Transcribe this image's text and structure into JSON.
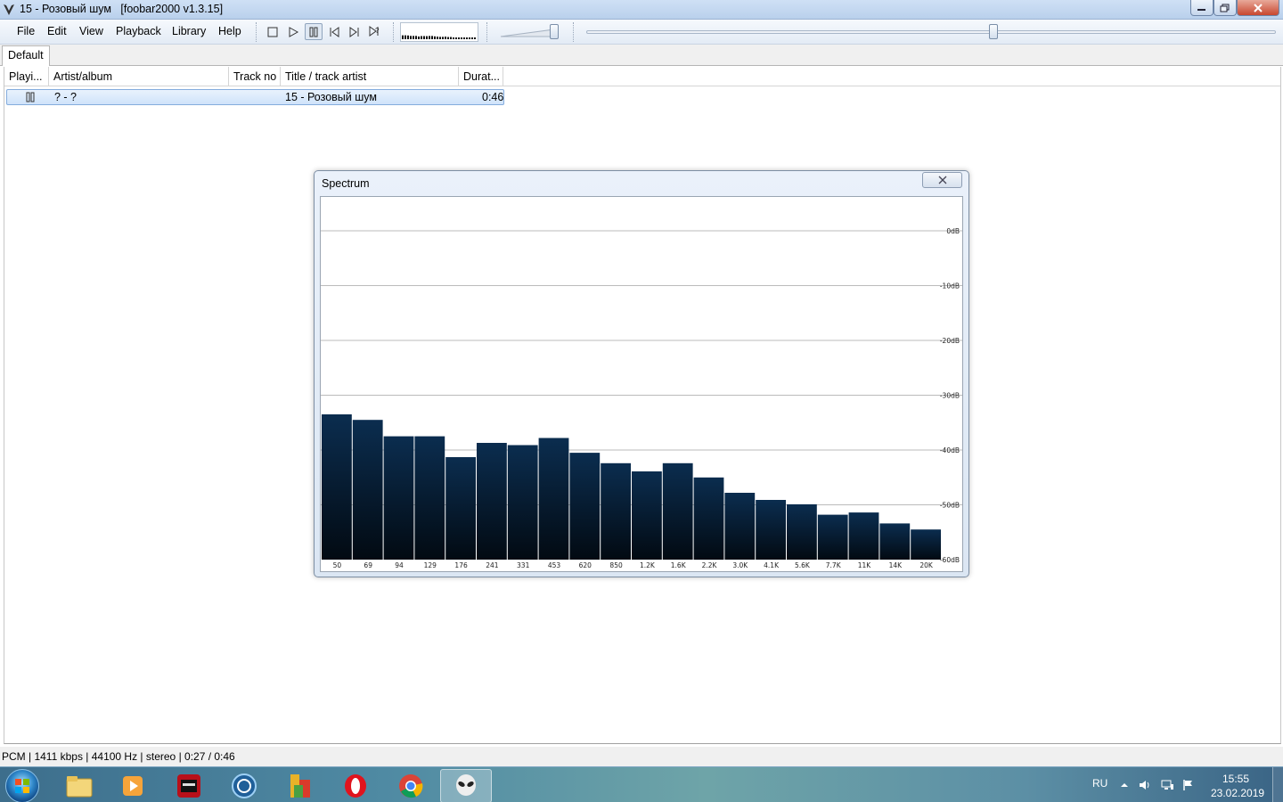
{
  "window": {
    "title": "15 - Розовый шум   [foobar2000 v1.3.15]"
  },
  "menu": [
    "File",
    "Edit",
    "View",
    "Playback",
    "Library",
    "Help"
  ],
  "tabs": [
    "Default"
  ],
  "playlist": {
    "columns": [
      "Playi...",
      "Artist/album",
      "Track no",
      "Title / track artist",
      "Durat..."
    ],
    "rows": [
      {
        "artist_album": "? - ?",
        "track_no": "",
        "title": "15 - Розовый шум",
        "duration": "0:46",
        "state": "paused"
      }
    ]
  },
  "seek": {
    "position_fraction": 0.59
  },
  "volume": {
    "level_fraction": 1.0
  },
  "spectrum": {
    "title": "Spectrum",
    "db_labels": [
      "0dB",
      "-10dB",
      "-20dB",
      "-30dB",
      "-40dB",
      "-50dB",
      "-60dB"
    ],
    "bands": [
      "50",
      "69",
      "94",
      "129",
      "176",
      "241",
      "331",
      "453",
      "620",
      "850",
      "1.2K",
      "1.6K",
      "2.2K",
      "3.0K",
      "4.1K",
      "5.6K",
      "7.7K",
      "11K",
      "14K",
      "20K"
    ],
    "levels_db": [
      -33.5,
      -34.5,
      -37.5,
      -37.5,
      -41.3,
      -38.7,
      -39.1,
      -37.8,
      -40.5,
      -42.4,
      -43.9,
      -42.4,
      -45.0,
      -47.8,
      -49.1,
      -49.9,
      -51.8,
      -51.4,
      -53.4,
      -54.5
    ]
  },
  "status": "PCM | 1411 kbps | 44100 Hz | stereo | 0:27 / 0:46",
  "taskbar": {
    "apps": [
      "explorer",
      "media-player",
      "sound-forge",
      "app-launcher",
      "winamp-like",
      "opera",
      "chrome",
      "foobar2000"
    ],
    "lang": "RU",
    "time": "15:55",
    "date": "23.02.2019"
  }
}
